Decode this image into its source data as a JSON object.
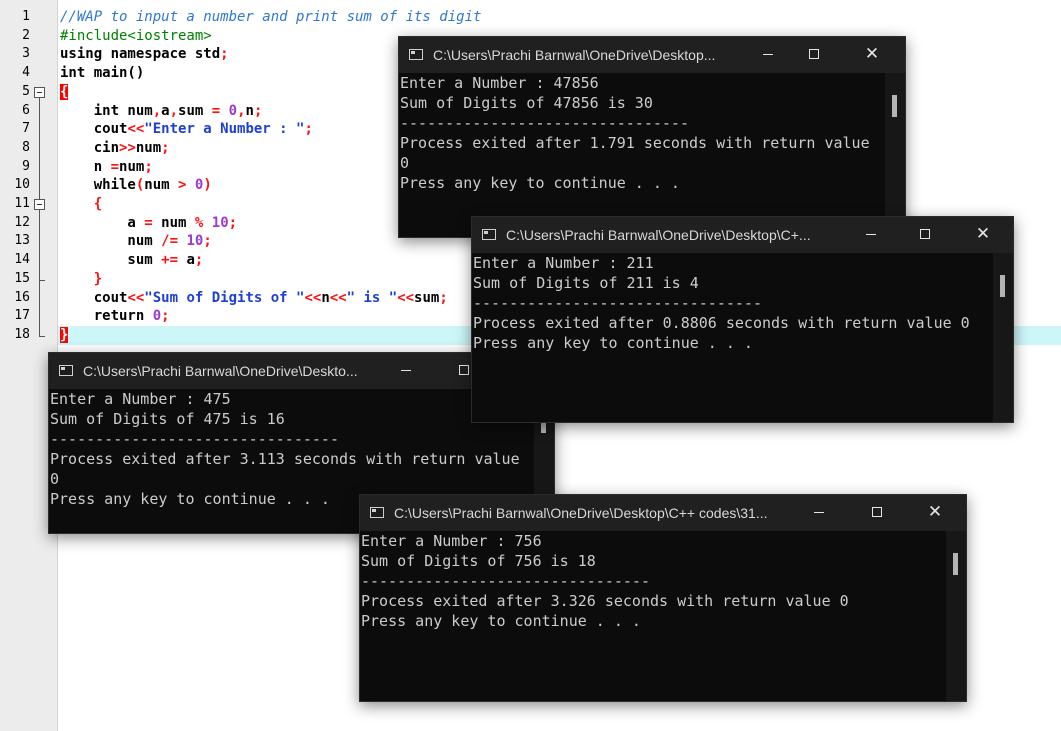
{
  "editor": {
    "line_numbers": [
      "1",
      "2",
      "3",
      "4",
      "5",
      "6",
      "7",
      "8",
      "9",
      "10",
      "11",
      "12",
      "13",
      "14",
      "15",
      "16",
      "17",
      "18"
    ],
    "lines": [
      [
        {
          "t": "//WAP to input a number and print sum of its digit",
          "c": "cmt"
        }
      ],
      [
        {
          "t": "#include<iostream>",
          "c": "pp"
        }
      ],
      [
        {
          "t": "using namespace std",
          "c": ""
        },
        {
          "t": ";",
          "c": "op"
        }
      ],
      [
        {
          "t": "int main()",
          "c": ""
        }
      ],
      [
        {
          "t": "{",
          "c": "brace-hl"
        }
      ],
      [
        {
          "t": "    int num",
          "c": ""
        },
        {
          "t": ",",
          "c": "op"
        },
        {
          "t": "a",
          "c": ""
        },
        {
          "t": ",",
          "c": "op"
        },
        {
          "t": "sum ",
          "c": ""
        },
        {
          "t": "=",
          "c": "op"
        },
        {
          "t": " ",
          "c": ""
        },
        {
          "t": "0",
          "c": "num"
        },
        {
          "t": ",",
          "c": "op"
        },
        {
          "t": "n",
          "c": ""
        },
        {
          "t": ";",
          "c": "op"
        }
      ],
      [
        {
          "t": "    cout",
          "c": ""
        },
        {
          "t": "<<",
          "c": "op"
        },
        {
          "t": "\"Enter a Number : \"",
          "c": "str"
        },
        {
          "t": ";",
          "c": "op"
        }
      ],
      [
        {
          "t": "    cin",
          "c": ""
        },
        {
          "t": ">>",
          "c": "op"
        },
        {
          "t": "num",
          "c": ""
        },
        {
          "t": ";",
          "c": "op"
        }
      ],
      [
        {
          "t": "    n ",
          "c": ""
        },
        {
          "t": "=",
          "c": "op"
        },
        {
          "t": "num",
          "c": ""
        },
        {
          "t": ";",
          "c": "op"
        }
      ],
      [
        {
          "t": "    while",
          "c": ""
        },
        {
          "t": "(",
          "c": "op"
        },
        {
          "t": "num ",
          "c": ""
        },
        {
          "t": ">",
          "c": "op"
        },
        {
          "t": " ",
          "c": ""
        },
        {
          "t": "0",
          "c": "num"
        },
        {
          "t": ")",
          "c": "op"
        }
      ],
      [
        {
          "t": "    ",
          "c": ""
        },
        {
          "t": "{",
          "c": "op"
        }
      ],
      [
        {
          "t": "        a ",
          "c": ""
        },
        {
          "t": "=",
          "c": "op"
        },
        {
          "t": " num ",
          "c": ""
        },
        {
          "t": "%",
          "c": "op"
        },
        {
          "t": " ",
          "c": ""
        },
        {
          "t": "10",
          "c": "num"
        },
        {
          "t": ";",
          "c": "op"
        }
      ],
      [
        {
          "t": "        num ",
          "c": ""
        },
        {
          "t": "/=",
          "c": "op"
        },
        {
          "t": " ",
          "c": ""
        },
        {
          "t": "10",
          "c": "num"
        },
        {
          "t": ";",
          "c": "op"
        }
      ],
      [
        {
          "t": "        sum ",
          "c": ""
        },
        {
          "t": "+=",
          "c": "op"
        },
        {
          "t": " a",
          "c": ""
        },
        {
          "t": ";",
          "c": "op"
        }
      ],
      [
        {
          "t": "    ",
          "c": ""
        },
        {
          "t": "}",
          "c": "op"
        }
      ],
      [
        {
          "t": "    cout",
          "c": ""
        },
        {
          "t": "<<",
          "c": "op"
        },
        {
          "t": "\"Sum of Digits of \"",
          "c": "str"
        },
        {
          "t": "<<",
          "c": "op"
        },
        {
          "t": "n",
          "c": ""
        },
        {
          "t": "<<",
          "c": "op"
        },
        {
          "t": "\" is \"",
          "c": "str"
        },
        {
          "t": "<<",
          "c": "op"
        },
        {
          "t": "sum",
          "c": ""
        },
        {
          "t": ";",
          "c": "op"
        }
      ],
      [
        {
          "t": "    return ",
          "c": ""
        },
        {
          "t": "0",
          "c": "num"
        },
        {
          "t": ";",
          "c": "op"
        }
      ],
      [
        {
          "t": "}",
          "c": "brace-hl"
        }
      ]
    ]
  },
  "windows": [
    {
      "title": "C:\\Users\\Prachi Barnwal\\OneDrive\\Desktop...",
      "lines": [
        "Enter a Number : 47856",
        "Sum of Digits of 47856 is 30",
        "--------------------------------",
        "Process exited after 1.791 seconds with return value",
        "0",
        "Press any key to continue . . ."
      ]
    },
    {
      "title": "C:\\Users\\Prachi Barnwal\\OneDrive\\Desktop\\C+...",
      "lines": [
        "Enter a Number : 211",
        "Sum of Digits of 211 is 4",
        "--------------------------------",
        "Process exited after 0.8806 seconds with return value 0",
        "Press any key to continue . . ."
      ]
    },
    {
      "title": "C:\\Users\\Prachi Barnwal\\OneDrive\\Deskto...",
      "lines": [
        "Enter a Number : 475",
        "Sum of Digits of 475 is 16",
        "--------------------------------",
        "Process exited after 3.113 seconds with return value",
        "0",
        "Press any key to continue . . ."
      ]
    },
    {
      "title": "C:\\Users\\Prachi Barnwal\\OneDrive\\Desktop\\C++ codes\\31...",
      "lines": [
        "Enter a Number : 756",
        "Sum of Digits of 756 is 18",
        "--------------------------------",
        "Process exited after 3.326 seconds with return value 0",
        "Press any key to continue . . ."
      ]
    }
  ],
  "controls": {
    "minimize": "—",
    "close": "✕"
  },
  "icons": {
    "window": "console-window-icon",
    "fold": "fold-minus-icon"
  }
}
